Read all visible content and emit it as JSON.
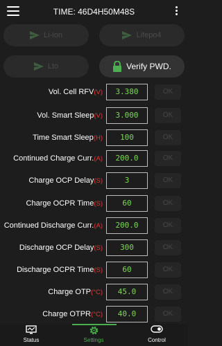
{
  "header": {
    "title": "TIME: 46D4H50M48S"
  },
  "modes": [
    {
      "label": "Li-ion"
    },
    {
      "label": "Lifepo4"
    },
    {
      "label": "Lto"
    }
  ],
  "verify": {
    "label": "Verify PWD."
  },
  "colors": {
    "value_text": "#7ed957",
    "unit_text": "#e53935",
    "accent": "#4caf50"
  },
  "settings": [
    {
      "label": "Vol. Cell RFV",
      "unit": "(V)",
      "value": "3.380",
      "ok": "OK"
    },
    {
      "label": "Vol. Smart Sleep",
      "unit": "(V)",
      "value": "3.000",
      "ok": "OK"
    },
    {
      "label": "Time Smart Sleep",
      "unit": "(H)",
      "value": "100",
      "ok": "OK"
    },
    {
      "label": "Continued Charge Curr.",
      "unit": "(A)",
      "value": "200.0",
      "ok": "OK"
    },
    {
      "label": "Charge OCP Delay",
      "unit": "(S)",
      "value": "3",
      "ok": "OK"
    },
    {
      "label": "Charge OCPR Time",
      "unit": "(S)",
      "value": "60",
      "ok": "OK"
    },
    {
      "label": "Continued Discharge Curr.",
      "unit": "(A)",
      "value": "200.0",
      "ok": "OK"
    },
    {
      "label": "Discharge OCP Delay",
      "unit": "(S)",
      "value": "300",
      "ok": "OK"
    },
    {
      "label": "Discharge OCPR Time",
      "unit": "(S)",
      "value": "60",
      "ok": "OK"
    },
    {
      "label": "Charge OTP",
      "unit": "(°C)",
      "value": "45.0",
      "ok": "OK"
    },
    {
      "label": "Charge OTPR",
      "unit": "(°C)",
      "value": "40.0",
      "ok": "OK"
    }
  ],
  "nav": [
    {
      "label": "Status",
      "icon": "monitor-icon"
    },
    {
      "label": "Settings",
      "icon": "gear-icon"
    },
    {
      "label": "Control",
      "icon": "toggle-icon"
    }
  ]
}
